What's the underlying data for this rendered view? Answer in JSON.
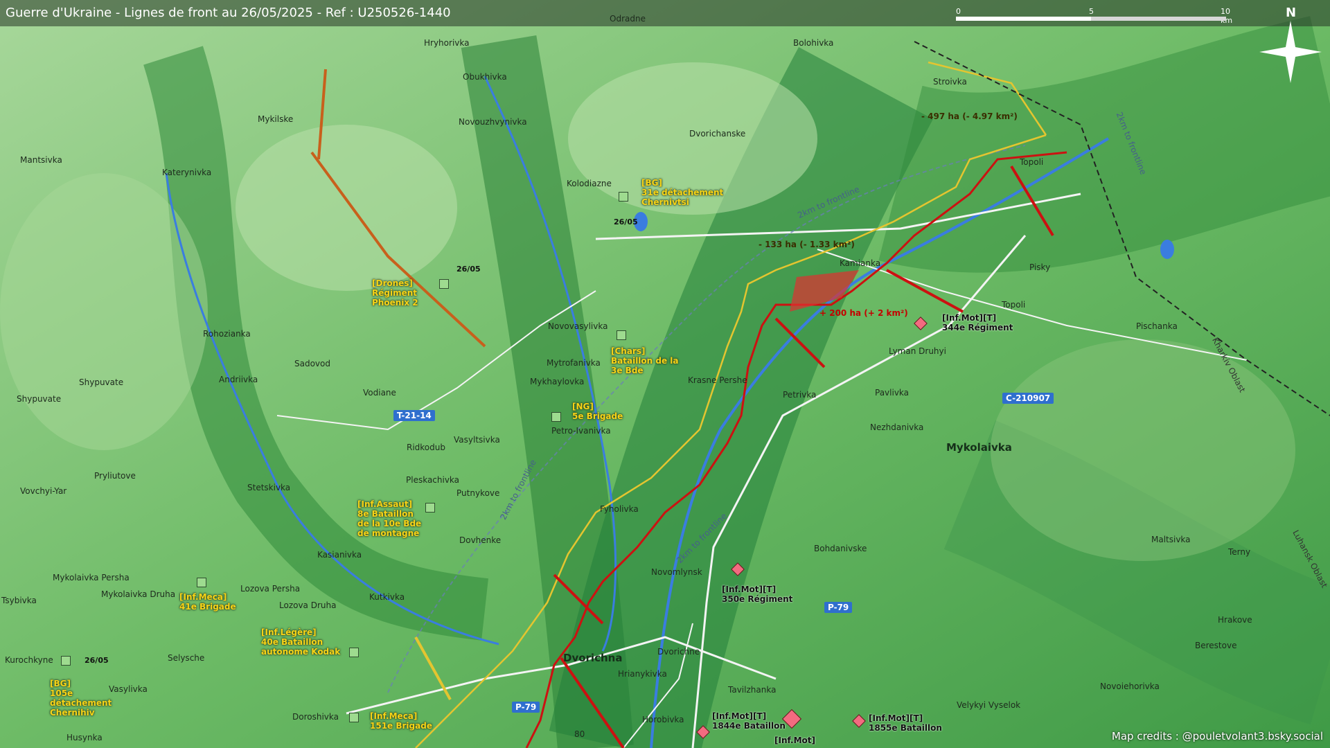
{
  "header": {
    "title": "Guerre d'Ukraine - Lignes de front au 26/05/2025 - Ref : U250526-1440"
  },
  "scale": {
    "ticks": [
      "0",
      "5",
      "10 km"
    ]
  },
  "compass": {
    "label": "N"
  },
  "credits": "Map credits : @pouletvolant3.bsky.social",
  "colors": {
    "frontline": "#cc1111",
    "ua_line": "#e4c530",
    "russian_gain": "#e03030",
    "land": "#5fae5c"
  },
  "places": [
    {
      "name": "Odradne",
      "big": false
    },
    {
      "name": "Bolohivka",
      "big": false
    },
    {
      "name": "Hryhorivka",
      "big": false
    },
    {
      "name": "Obukhivka",
      "big": false
    },
    {
      "name": "Stroivka",
      "big": false
    },
    {
      "name": "Mykilske",
      "big": false
    },
    {
      "name": "Novouzhvynivka",
      "big": false
    },
    {
      "name": "Dvorichanske",
      "big": false
    },
    {
      "name": "Mantsivka",
      "big": false
    },
    {
      "name": "Katerynivka",
      "big": false
    },
    {
      "name": "Kolodiazne",
      "big": false
    },
    {
      "name": "Topoli",
      "big": false
    },
    {
      "name": "Kamianka",
      "big": false
    },
    {
      "name": "Pisky",
      "big": false
    },
    {
      "name": "Topoli",
      "big": false
    },
    {
      "name": "Pischanka",
      "big": false
    },
    {
      "name": "Rohozianka",
      "big": false
    },
    {
      "name": "Novovasylivka",
      "big": false
    },
    {
      "name": "Lyman Druhyi",
      "big": false
    },
    {
      "name": "Sadovod",
      "big": false
    },
    {
      "name": "Mytrofanivka",
      "big": false
    },
    {
      "name": "Shypuvate",
      "big": false
    },
    {
      "name": "Andriivka",
      "big": false
    },
    {
      "name": "Mykhaylovka",
      "big": false
    },
    {
      "name": "Krasne Pershe",
      "big": false
    },
    {
      "name": "Vodiane",
      "big": false
    },
    {
      "name": "Petrivka",
      "big": false
    },
    {
      "name": "Pavlivka",
      "big": false
    },
    {
      "name": "Shypuvate",
      "big": false
    },
    {
      "name": "Nezhdanivka",
      "big": false
    },
    {
      "name": "Mykolaivka",
      "big": true
    },
    {
      "name": "Petro-Ivanivka",
      "big": false
    },
    {
      "name": "Ridkodub",
      "big": false
    },
    {
      "name": "Vasyltsivka",
      "big": false
    },
    {
      "name": "Pryliutove",
      "big": false
    },
    {
      "name": "Pleskachivka",
      "big": false
    },
    {
      "name": "Stetskivka",
      "big": false
    },
    {
      "name": "Vovchyi-Yar",
      "big": false
    },
    {
      "name": "Putnykove",
      "big": false
    },
    {
      "name": "Fyholivka",
      "big": false
    },
    {
      "name": "Dovhenke",
      "big": false
    },
    {
      "name": "Maltsivka",
      "big": false
    },
    {
      "name": "Bohdanivske",
      "big": false
    },
    {
      "name": "Kasianivka",
      "big": false
    },
    {
      "name": "Terny",
      "big": false
    },
    {
      "name": "Mykolaivka Persha",
      "big": false
    },
    {
      "name": "Novomlynsk",
      "big": false
    },
    {
      "name": "Lozova Persha",
      "big": false
    },
    {
      "name": "Mykolaivka Druha",
      "big": false
    },
    {
      "name": "Kutkivka",
      "big": false
    },
    {
      "name": "Tsybivka",
      "big": false
    },
    {
      "name": "Lozova Druha",
      "big": false
    },
    {
      "name": "Hrakove",
      "big": false
    },
    {
      "name": "Dvorichna",
      "big": true
    },
    {
      "name": "Dvorichne",
      "big": false
    },
    {
      "name": "Selysche",
      "big": false
    },
    {
      "name": "Kurochkyne",
      "big": false
    },
    {
      "name": "Berestove",
      "big": false
    },
    {
      "name": "Hrianykivka",
      "big": false
    },
    {
      "name": "Tavilzhanka",
      "big": false
    },
    {
      "name": "Vasylivka",
      "big": false
    },
    {
      "name": "Novoiehorivka",
      "big": false
    },
    {
      "name": "Doroshivka",
      "big": false
    },
    {
      "name": "Horobivka",
      "big": false
    },
    {
      "name": "Velykyi Vyselok",
      "big": false
    },
    {
      "name": "Husynka",
      "big": false
    }
  ],
  "units": [
    {
      "lines": [
        "[BG]",
        "31e détachement",
        "Chernivtsi"
      ],
      "side": "ua"
    },
    {
      "lines": [
        "[Drones]",
        "Régiment",
        "Phoenix 2"
      ],
      "side": "ua"
    },
    {
      "lines": [
        "[Chars]",
        "Bataillon de la",
        "3e Bde"
      ],
      "side": "ua"
    },
    {
      "lines": [
        "[NG]",
        "5e Brigade"
      ],
      "side": "ua"
    },
    {
      "lines": [
        "[Inf.Assaut]",
        "8e Bataillon",
        "de la 10e Bde",
        "de montagne"
      ],
      "side": "ua"
    },
    {
      "lines": [
        "[Inf.Meca]",
        "41e Brigade"
      ],
      "side": "ua"
    },
    {
      "lines": [
        "[Inf.Légère]",
        "40e Bataillon",
        "autonome Kodak"
      ],
      "side": "ua"
    },
    {
      "lines": [
        "[BG]",
        "105e",
        "détachement",
        "Chernihiv"
      ],
      "side": "ua"
    },
    {
      "lines": [
        "[Inf.Meca]",
        "151e Brigade"
      ],
      "side": "ua"
    },
    {
      "lines": [
        "[Inf.Mot][T]",
        "344e Régiment"
      ],
      "side": "ru"
    },
    {
      "lines": [
        "[Inf.Mot][T]",
        "350e Régiment"
      ],
      "side": "ru"
    },
    {
      "lines": [
        "[Inf.Mot][T]",
        "1844e Bataillon"
      ],
      "side": "ru"
    },
    {
      "lines": [
        "[Inf.Mot][T]",
        "1855e Bataillon"
      ],
      "side": "ru"
    },
    {
      "lines": [
        "[Inf.Mot]"
      ],
      "side": "ru"
    }
  ],
  "dates": [
    "26/05",
    "26/05",
    "26/05"
  ],
  "gains": [
    {
      "text": "- 497 ha (- 4.97 km²)",
      "kind": "loss"
    },
    {
      "text": "- 133 ha (- 1.33 km²)",
      "kind": "loss"
    },
    {
      "text": "+ 200 ha (+ 2 km²)",
      "kind": "win"
    }
  ],
  "roads": [
    "T-21-14",
    "C-210907",
    "P-79",
    "P-79",
    "80"
  ],
  "frontline_notes": [
    "2km to frontline",
    "2km to frontline",
    "2km to frontline",
    "2km to frontline"
  ],
  "regions": [
    "Kharkiv Oblast",
    "Luhansk Oblast"
  ]
}
